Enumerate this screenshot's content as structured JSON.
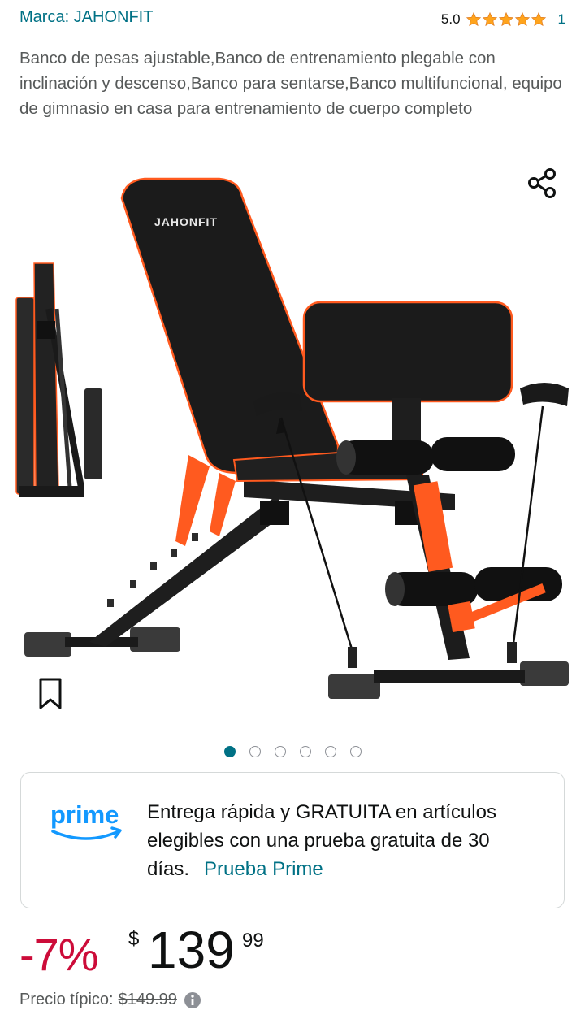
{
  "brand": {
    "label": "Marca: JAHONFIT"
  },
  "rating": {
    "value": "5.0",
    "stars": 5,
    "count": "1"
  },
  "product": {
    "title": "Banco de pesas ajustable,Banco de entrenamiento plegable con inclinación y descenso,Banco para sentarse,Banco multifuncional, equipo de gimnasio en casa para entrenamiento de cuerpo completo",
    "image_logo_text": "JAHONFIT"
  },
  "carousel": {
    "total": 6,
    "active": 1
  },
  "prime": {
    "logo_text": "prime",
    "message": "Entrega rápida y GRATUITA en artículos elegibles con una prueba gratuita de 30 días.",
    "link": "Prueba Prime"
  },
  "price": {
    "discount": "-7%",
    "currency": "$",
    "whole": "139",
    "fraction": "99",
    "typical_label": "Precio típico:",
    "typical_value": "$149.99"
  },
  "icons": [
    "share-icon",
    "bookmark-icon",
    "star-icon",
    "info-icon"
  ],
  "colors": {
    "link": "#007185",
    "star": "#ffa41c",
    "discount": "#cc0c39",
    "prime_blue": "#1399ff",
    "accent_orange": "#ff5a1f"
  }
}
